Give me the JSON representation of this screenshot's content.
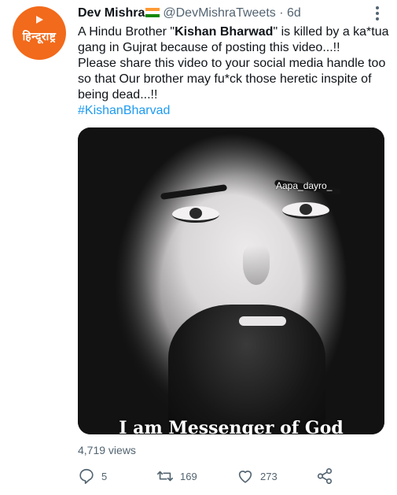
{
  "author": {
    "avatar_text": "हिन्दूराष्ट्र",
    "name": "Dev Mishra",
    "handle": "@DevMishraTweets",
    "separator": "·",
    "time": "6d"
  },
  "tweet": {
    "line1_prefix": "A Hindu Brother \"",
    "line1_bold": "Kishan Bharwad",
    "line1_suffix": "\" is killed by a ka*tua gang in Gujrat because of posting this video...!!",
    "line2": "Please share this video to your social media handle too so that Our brother may fu*ck those heretic inspite of being dead...!!",
    "hashtag": "#KishanBharvad"
  },
  "media": {
    "watermark": "Aapa_dayro_",
    "caption": "I am Messenger of God"
  },
  "views": "4,719 views",
  "actions": {
    "replies": "5",
    "retweets": "169",
    "likes": "273"
  },
  "colors": {
    "avatar_bg": "#f26a1b",
    "link": "#1d9bf0",
    "secondary_text": "#536471"
  },
  "icons": [
    "more-options-icon",
    "reply-icon",
    "retweet-icon",
    "like-icon",
    "share-icon",
    "india-flag-icon"
  ]
}
